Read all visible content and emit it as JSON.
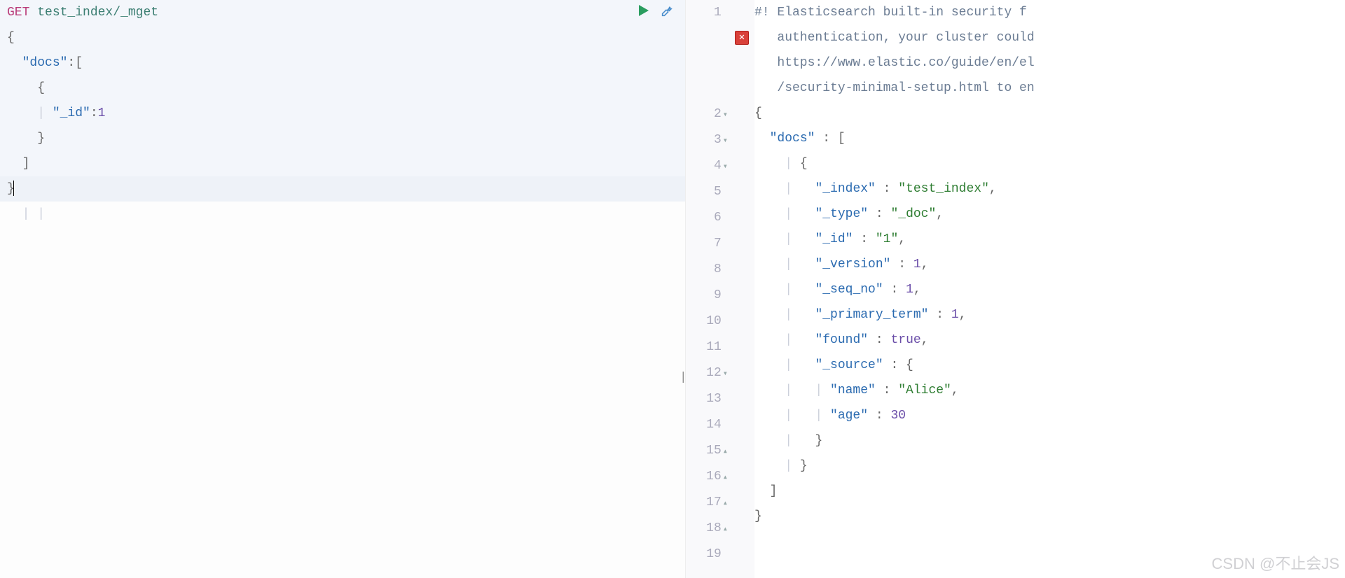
{
  "request": {
    "method": "GET",
    "endpoint": "test_index/_mget",
    "bodyLines": [
      [
        {
          "t": "punc",
          "v": "{"
        }
      ],
      [
        {
          "t": "pad",
          "v": "  "
        },
        {
          "t": "key",
          "v": "\"docs\""
        },
        {
          "t": "punc",
          "v": ":["
        }
      ],
      [
        {
          "t": "pad",
          "v": "    "
        },
        {
          "t": "punc",
          "v": "{"
        }
      ],
      [
        {
          "t": "pad",
          "v": "    "
        },
        {
          "t": "guide",
          "v": "| "
        },
        {
          "t": "key",
          "v": "\"_id\""
        },
        {
          "t": "punc",
          "v": ":"
        },
        {
          "t": "num",
          "v": "1"
        }
      ],
      [
        {
          "t": "pad",
          "v": "    "
        },
        {
          "t": "punc",
          "v": "}"
        }
      ],
      [
        {
          "t": "pad",
          "v": "  "
        },
        {
          "t": "punc",
          "v": "]"
        }
      ],
      [
        {
          "t": "punc",
          "v": "}"
        }
      ]
    ]
  },
  "response": {
    "gutter": [
      {
        "ln": "1",
        "fold": ""
      },
      {
        "ln": "2",
        "fold": "▾"
      },
      {
        "ln": "3",
        "fold": "▾"
      },
      {
        "ln": "4",
        "fold": "▾"
      },
      {
        "ln": "5",
        "fold": ""
      },
      {
        "ln": "6",
        "fold": ""
      },
      {
        "ln": "7",
        "fold": ""
      },
      {
        "ln": "8",
        "fold": ""
      },
      {
        "ln": "9",
        "fold": ""
      },
      {
        "ln": "10",
        "fold": ""
      },
      {
        "ln": "11",
        "fold": ""
      },
      {
        "ln": "12",
        "fold": "▾"
      },
      {
        "ln": "13",
        "fold": ""
      },
      {
        "ln": "14",
        "fold": ""
      },
      {
        "ln": "15",
        "fold": "▴"
      },
      {
        "ln": "16",
        "fold": "▴"
      },
      {
        "ln": "17",
        "fold": "▴"
      },
      {
        "ln": "18",
        "fold": "▴"
      },
      {
        "ln": "19",
        "fold": ""
      }
    ],
    "lines": [
      [
        {
          "t": "comment",
          "v": "#! Elasticsearch built-in security f"
        }
      ],
      [
        {
          "t": "comment",
          "v": "   authentication, your cluster could"
        }
      ],
      [
        {
          "t": "comment",
          "v": "   https://www.elastic.co/guide/en/el"
        }
      ],
      [
        {
          "t": "comment",
          "v": "   /security-minimal-setup.html to en"
        }
      ],
      [
        {
          "t": "punc",
          "v": "{"
        }
      ],
      [
        {
          "t": "pad",
          "v": "  "
        },
        {
          "t": "key",
          "v": "\"docs\""
        },
        {
          "t": "punc",
          "v": " : ["
        }
      ],
      [
        {
          "t": "pad",
          "v": "    "
        },
        {
          "t": "guide",
          "v": "| "
        },
        {
          "t": "punc",
          "v": "{"
        }
      ],
      [
        {
          "t": "pad",
          "v": "    "
        },
        {
          "t": "guide",
          "v": "|   "
        },
        {
          "t": "key",
          "v": "\"_index\""
        },
        {
          "t": "punc",
          "v": " : "
        },
        {
          "t": "str",
          "v": "\"test_index\""
        },
        {
          "t": "punc",
          "v": ","
        }
      ],
      [
        {
          "t": "pad",
          "v": "    "
        },
        {
          "t": "guide",
          "v": "|   "
        },
        {
          "t": "key",
          "v": "\"_type\""
        },
        {
          "t": "punc",
          "v": " : "
        },
        {
          "t": "str",
          "v": "\"_doc\""
        },
        {
          "t": "punc",
          "v": ","
        }
      ],
      [
        {
          "t": "pad",
          "v": "    "
        },
        {
          "t": "guide",
          "v": "|   "
        },
        {
          "t": "key",
          "v": "\"_id\""
        },
        {
          "t": "punc",
          "v": " : "
        },
        {
          "t": "str",
          "v": "\"1\""
        },
        {
          "t": "punc",
          "v": ","
        }
      ],
      [
        {
          "t": "pad",
          "v": "    "
        },
        {
          "t": "guide",
          "v": "|   "
        },
        {
          "t": "key",
          "v": "\"_version\""
        },
        {
          "t": "punc",
          "v": " : "
        },
        {
          "t": "num",
          "v": "1"
        },
        {
          "t": "punc",
          "v": ","
        }
      ],
      [
        {
          "t": "pad",
          "v": "    "
        },
        {
          "t": "guide",
          "v": "|   "
        },
        {
          "t": "key",
          "v": "\"_seq_no\""
        },
        {
          "t": "punc",
          "v": " : "
        },
        {
          "t": "num",
          "v": "1"
        },
        {
          "t": "punc",
          "v": ","
        }
      ],
      [
        {
          "t": "pad",
          "v": "    "
        },
        {
          "t": "guide",
          "v": "|   "
        },
        {
          "t": "key",
          "v": "\"_primary_term\""
        },
        {
          "t": "punc",
          "v": " : "
        },
        {
          "t": "num",
          "v": "1"
        },
        {
          "t": "punc",
          "v": ","
        }
      ],
      [
        {
          "t": "pad",
          "v": "    "
        },
        {
          "t": "guide",
          "v": "|   "
        },
        {
          "t": "key",
          "v": "\"found\""
        },
        {
          "t": "punc",
          "v": " : "
        },
        {
          "t": "bool",
          "v": "true"
        },
        {
          "t": "punc",
          "v": ","
        }
      ],
      [
        {
          "t": "pad",
          "v": "    "
        },
        {
          "t": "guide",
          "v": "|   "
        },
        {
          "t": "key",
          "v": "\"_source\""
        },
        {
          "t": "punc",
          "v": " : {"
        }
      ],
      [
        {
          "t": "pad",
          "v": "    "
        },
        {
          "t": "guide",
          "v": "|   | "
        },
        {
          "t": "key",
          "v": "\"name\""
        },
        {
          "t": "punc",
          "v": " : "
        },
        {
          "t": "str",
          "v": "\"Alice\""
        },
        {
          "t": "punc",
          "v": ","
        }
      ],
      [
        {
          "t": "pad",
          "v": "    "
        },
        {
          "t": "guide",
          "v": "|   | "
        },
        {
          "t": "key",
          "v": "\"age\""
        },
        {
          "t": "punc",
          "v": " : "
        },
        {
          "t": "num",
          "v": "30"
        }
      ],
      [
        {
          "t": "pad",
          "v": "    "
        },
        {
          "t": "guide",
          "v": "|   "
        },
        {
          "t": "punc",
          "v": "}"
        }
      ],
      [
        {
          "t": "pad",
          "v": "    "
        },
        {
          "t": "guide",
          "v": "| "
        },
        {
          "t": "punc",
          "v": "}"
        }
      ],
      [
        {
          "t": "pad",
          "v": "  "
        },
        {
          "t": "punc",
          "v": "]"
        }
      ],
      [
        {
          "t": "punc",
          "v": "}"
        }
      ],
      [
        {
          "t": "pad",
          "v": " "
        }
      ]
    ],
    "errorBadge": "✕"
  },
  "watermark": "CSDN @不止会JS"
}
